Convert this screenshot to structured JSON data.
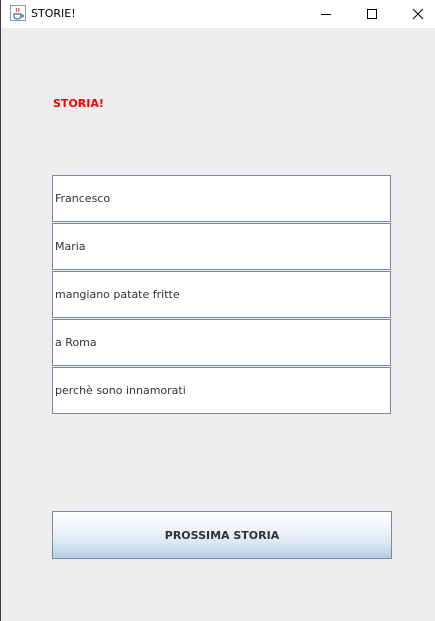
{
  "window": {
    "title": "STORIE!",
    "icon": "java-cup-icon"
  },
  "main": {
    "heading": "STORIA!",
    "heading_color": "#ff0000",
    "fields": [
      {
        "value": "Francesco"
      },
      {
        "value": "Maria"
      },
      {
        "value": "mangiano patate fritte"
      },
      {
        "value": "a Roma"
      },
      {
        "value": "perchè sono innamorati"
      }
    ],
    "next_button_label": "PROSSIMA STORIA"
  }
}
